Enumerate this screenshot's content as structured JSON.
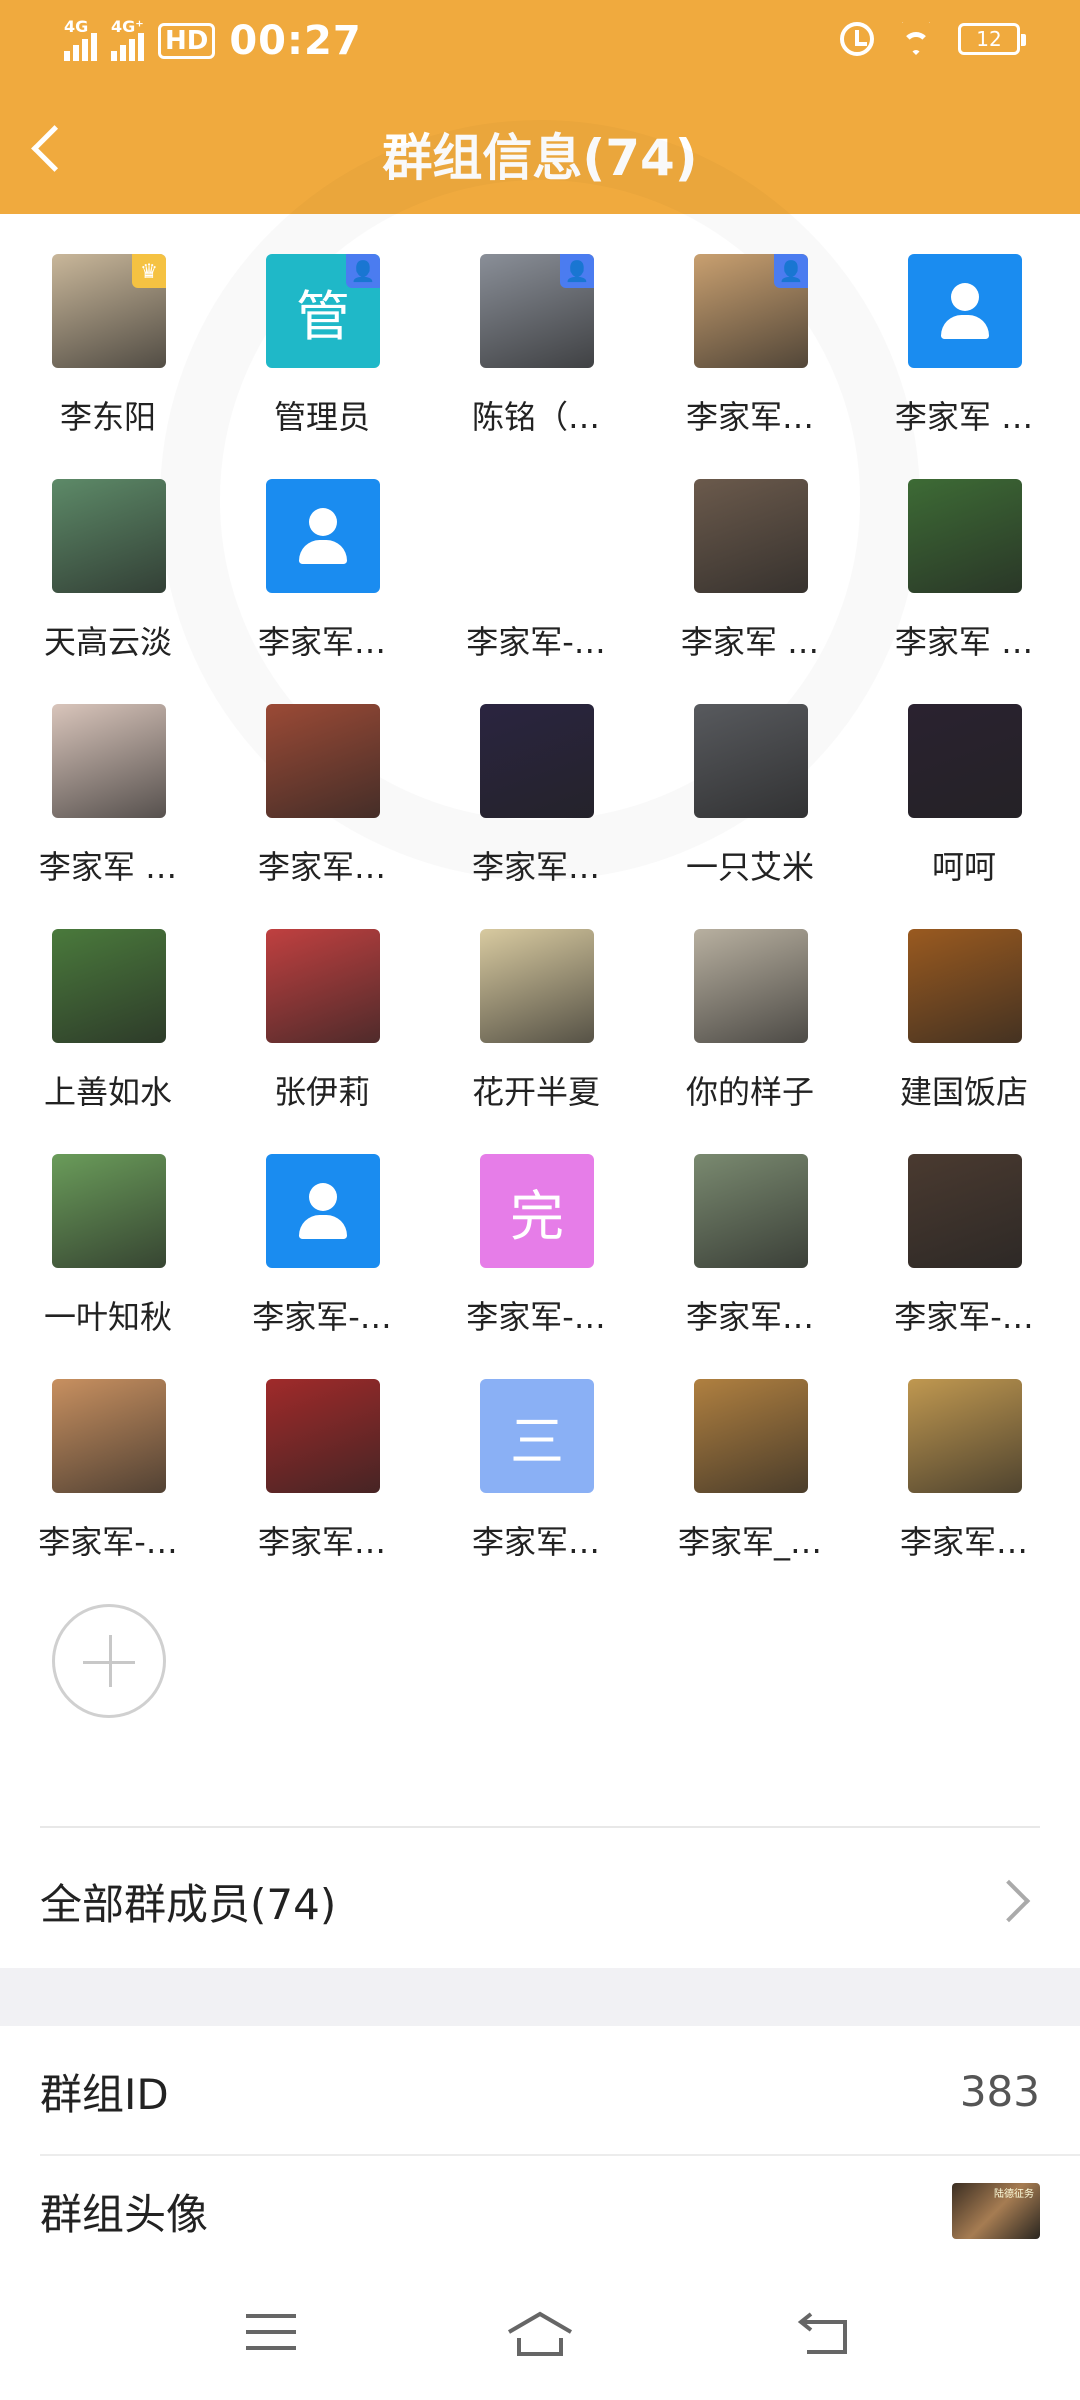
{
  "status_bar": {
    "signal1": "4G",
    "signal2": "4G⁺",
    "hd": "HD",
    "time": "00:27",
    "battery": "12"
  },
  "header": {
    "title": "群组信息(74)"
  },
  "members": [
    {
      "name": "李东阳",
      "avatar_type": "photo",
      "color": "#c9b79a",
      "badge": "owner"
    },
    {
      "name": "管理员",
      "avatar_type": "glyph",
      "glyph": "管",
      "color": "#1fb8c8",
      "badge": "admin"
    },
    {
      "name": "陈铭（…",
      "avatar_type": "photo",
      "color": "#8a8f98",
      "badge": "admin"
    },
    {
      "name": "李家军…",
      "avatar_type": "photo",
      "color": "#c9a070",
      "badge": "admin"
    },
    {
      "name": "李家军 …",
      "avatar_type": "person",
      "color": "#1a8cf0",
      "badge": ""
    },
    {
      "name": "天高云淡",
      "avatar_type": "photo",
      "color": "#5d8a68",
      "badge": ""
    },
    {
      "name": "李家军…",
      "avatar_type": "person",
      "color": "#1a8cf0",
      "badge": ""
    },
    {
      "name": "李家军-…",
      "avatar_type": "blank",
      "color": "#ffffff",
      "badge": ""
    },
    {
      "name": "李家军 …",
      "avatar_type": "photo",
      "color": "#6b5a4c",
      "badge": ""
    },
    {
      "name": "李家军 …",
      "avatar_type": "photo",
      "color": "#3d6b35",
      "badge": ""
    },
    {
      "name": "李家军 …",
      "avatar_type": "photo",
      "color": "#d9c5bb",
      "badge": ""
    },
    {
      "name": "李家军…",
      "avatar_type": "photo",
      "color": "#9b4a36",
      "badge": ""
    },
    {
      "name": "李家军…",
      "avatar_type": "photo",
      "color": "#2a2440",
      "badge": ""
    },
    {
      "name": "一只艾米",
      "avatar_type": "photo",
      "color": "#585a5e",
      "badge": ""
    },
    {
      "name": "呵呵",
      "avatar_type": "photo",
      "color": "#2a2230",
      "badge": ""
    },
    {
      "name": "上善如水",
      "avatar_type": "photo",
      "color": "#4a7a3c",
      "badge": ""
    },
    {
      "name": "张伊莉",
      "avatar_type": "photo",
      "color": "#c04040",
      "badge": ""
    },
    {
      "name": "花开半夏",
      "avatar_type": "photo",
      "color": "#d8caa0",
      "badge": ""
    },
    {
      "name": "你的样子",
      "avatar_type": "photo",
      "color": "#b8b0a0",
      "badge": ""
    },
    {
      "name": "建国饭店",
      "avatar_type": "photo",
      "color": "#9a5a20",
      "badge": ""
    },
    {
      "name": "一叶知秋",
      "avatar_type": "photo",
      "color": "#6a9c5a",
      "badge": ""
    },
    {
      "name": "李家军-…",
      "avatar_type": "person",
      "color": "#1a8cf0",
      "badge": ""
    },
    {
      "name": "李家军-…",
      "avatar_type": "glyph",
      "glyph": "完",
      "color": "#e67de8",
      "badge": ""
    },
    {
      "name": "李家军…",
      "avatar_type": "photo",
      "color": "#7a8a70",
      "badge": ""
    },
    {
      "name": "李家军-…",
      "avatar_type": "photo",
      "color": "#4a3a30",
      "badge": ""
    },
    {
      "name": "李家军-…",
      "avatar_type": "photo",
      "color": "#c89060",
      "badge": ""
    },
    {
      "name": "李家军…",
      "avatar_type": "photo",
      "color": "#a02a2a",
      "badge": ""
    },
    {
      "name": "李家军…",
      "avatar_type": "glyph",
      "glyph": "三",
      "color": "#8ab0f5",
      "badge": ""
    },
    {
      "name": "李家军_…",
      "avatar_type": "photo",
      "color": "#b08040",
      "badge": ""
    },
    {
      "name": "李家军…",
      "avatar_type": "photo",
      "color": "#c09850",
      "badge": ""
    }
  ],
  "all_members": {
    "label": "全部群成员(74)"
  },
  "group_id": {
    "label": "群组ID",
    "value": "383"
  },
  "group_avatar": {
    "label": "群组头像",
    "thumb_text": "陆德征务"
  }
}
